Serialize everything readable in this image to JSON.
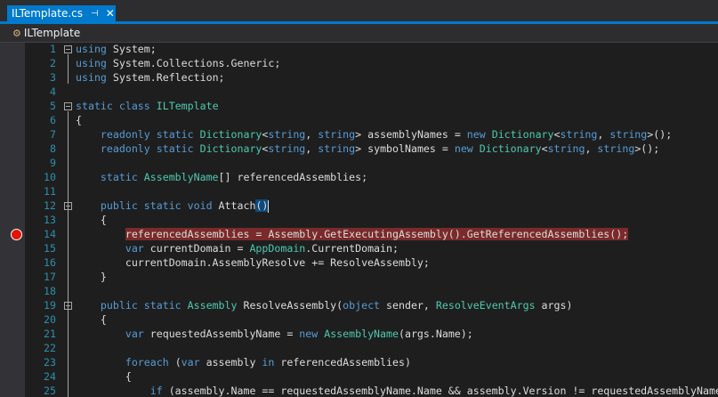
{
  "tab": {
    "title": "ILTemplate.cs",
    "pin_icon": "pin-icon",
    "close_icon": "close-icon"
  },
  "nav": {
    "class_name": "ILTemplate"
  },
  "breakpoint_line": 14,
  "code": {
    "lines": [
      {
        "n": "1",
        "fold": true,
        "tokens": [
          {
            "t": "using",
            "c": "kw"
          },
          {
            "t": " System;",
            "c": "pl"
          }
        ]
      },
      {
        "n": "2",
        "tokens": [
          {
            "t": "using",
            "c": "kw"
          },
          {
            "t": " System.Collections.Generic;",
            "c": "pl"
          }
        ]
      },
      {
        "n": "3",
        "tokens": [
          {
            "t": "using",
            "c": "kw"
          },
          {
            "t": " System.Reflection;",
            "c": "pl"
          }
        ]
      },
      {
        "n": "4",
        "tokens": []
      },
      {
        "n": "5",
        "fold": true,
        "tokens": [
          {
            "t": "static class ",
            "c": "kw"
          },
          {
            "t": "ILTemplate",
            "c": "ty"
          }
        ]
      },
      {
        "n": "6",
        "tokens": [
          {
            "t": "{",
            "c": "pl"
          }
        ]
      },
      {
        "n": "7",
        "tokens": [
          {
            "t": "    readonly static ",
            "c": "kw"
          },
          {
            "t": "Dictionary",
            "c": "ty"
          },
          {
            "t": "<",
            "c": "pl"
          },
          {
            "t": "string",
            "c": "kw"
          },
          {
            "t": ", ",
            "c": "pl"
          },
          {
            "t": "string",
            "c": "kw"
          },
          {
            "t": "> assemblyNames = ",
            "c": "pl"
          },
          {
            "t": "new ",
            "c": "kw"
          },
          {
            "t": "Dictionary",
            "c": "ty"
          },
          {
            "t": "<",
            "c": "pl"
          },
          {
            "t": "string",
            "c": "kw"
          },
          {
            "t": ", ",
            "c": "pl"
          },
          {
            "t": "string",
            "c": "kw"
          },
          {
            "t": ">();",
            "c": "pl"
          }
        ]
      },
      {
        "n": "8",
        "tokens": [
          {
            "t": "    readonly static ",
            "c": "kw"
          },
          {
            "t": "Dictionary",
            "c": "ty"
          },
          {
            "t": "<",
            "c": "pl"
          },
          {
            "t": "string",
            "c": "kw"
          },
          {
            "t": ", ",
            "c": "pl"
          },
          {
            "t": "string",
            "c": "kw"
          },
          {
            "t": "> symbolNames = ",
            "c": "pl"
          },
          {
            "t": "new ",
            "c": "kw"
          },
          {
            "t": "Dictionary",
            "c": "ty"
          },
          {
            "t": "<",
            "c": "pl"
          },
          {
            "t": "string",
            "c": "kw"
          },
          {
            "t": ", ",
            "c": "pl"
          },
          {
            "t": "string",
            "c": "kw"
          },
          {
            "t": ">();",
            "c": "pl"
          }
        ]
      },
      {
        "n": "9",
        "tokens": []
      },
      {
        "n": "10",
        "tokens": [
          {
            "t": "    static ",
            "c": "kw"
          },
          {
            "t": "AssemblyName",
            "c": "ty"
          },
          {
            "t": "[] referencedAssemblies;",
            "c": "pl"
          }
        ]
      },
      {
        "n": "11",
        "tokens": []
      },
      {
        "n": "12",
        "fold": true,
        "tokens": [
          {
            "t": "    public static void ",
            "c": "kw"
          },
          {
            "t": "Attach",
            "c": "pl"
          },
          {
            "t": "()",
            "c": "pl brace"
          }
        ]
      },
      {
        "n": "13",
        "tokens": [
          {
            "t": "    {",
            "c": "pl"
          }
        ]
      },
      {
        "n": "14",
        "tokens": [
          {
            "t": "        ",
            "c": "pl"
          },
          {
            "t": "referencedAssemblies = Assembly.GetExecutingAssembly().GetReferencedAssemblies();",
            "c": "pl hl"
          }
        ]
      },
      {
        "n": "15",
        "tokens": [
          {
            "t": "        var ",
            "c": "kw"
          },
          {
            "t": "currentDomain = ",
            "c": "pl"
          },
          {
            "t": "AppDomain",
            "c": "ty"
          },
          {
            "t": ".CurrentDomain;",
            "c": "pl"
          }
        ]
      },
      {
        "n": "16",
        "tokens": [
          {
            "t": "        currentDomain.AssemblyResolve += ResolveAssembly;",
            "c": "pl"
          }
        ]
      },
      {
        "n": "17",
        "tokens": [
          {
            "t": "    }",
            "c": "pl"
          }
        ]
      },
      {
        "n": "18",
        "tokens": []
      },
      {
        "n": "19",
        "fold": true,
        "tokens": [
          {
            "t": "    public static ",
            "c": "kw"
          },
          {
            "t": "Assembly",
            "c": "ty"
          },
          {
            "t": " ResolveAssembly(",
            "c": "pl"
          },
          {
            "t": "object",
            "c": "kw"
          },
          {
            "t": " sender, ",
            "c": "pl"
          },
          {
            "t": "ResolveEventArgs",
            "c": "ty"
          },
          {
            "t": " args)",
            "c": "pl"
          }
        ]
      },
      {
        "n": "20",
        "tokens": [
          {
            "t": "    {",
            "c": "pl"
          }
        ]
      },
      {
        "n": "21",
        "tokens": [
          {
            "t": "        var ",
            "c": "kw"
          },
          {
            "t": "requestedAssemblyName = ",
            "c": "pl"
          },
          {
            "t": "new ",
            "c": "kw"
          },
          {
            "t": "AssemblyName",
            "c": "ty"
          },
          {
            "t": "(args.Name);",
            "c": "pl"
          }
        ]
      },
      {
        "n": "22",
        "tokens": []
      },
      {
        "n": "23",
        "tokens": [
          {
            "t": "        foreach ",
            "c": "kw"
          },
          {
            "t": "(",
            "c": "pl"
          },
          {
            "t": "var ",
            "c": "kw"
          },
          {
            "t": "assembly ",
            "c": "pl"
          },
          {
            "t": "in ",
            "c": "kw"
          },
          {
            "t": "referencedAssemblies)",
            "c": "pl"
          }
        ]
      },
      {
        "n": "24",
        "tokens": [
          {
            "t": "        {",
            "c": "pl"
          }
        ]
      },
      {
        "n": "25",
        "tokens": [
          {
            "t": "            if ",
            "c": "kw"
          },
          {
            "t": "(assembly.Name == requestedAssemblyName.Name && assembly.Version != requestedAssemblyName",
            "c": "pl"
          }
        ]
      }
    ]
  }
}
